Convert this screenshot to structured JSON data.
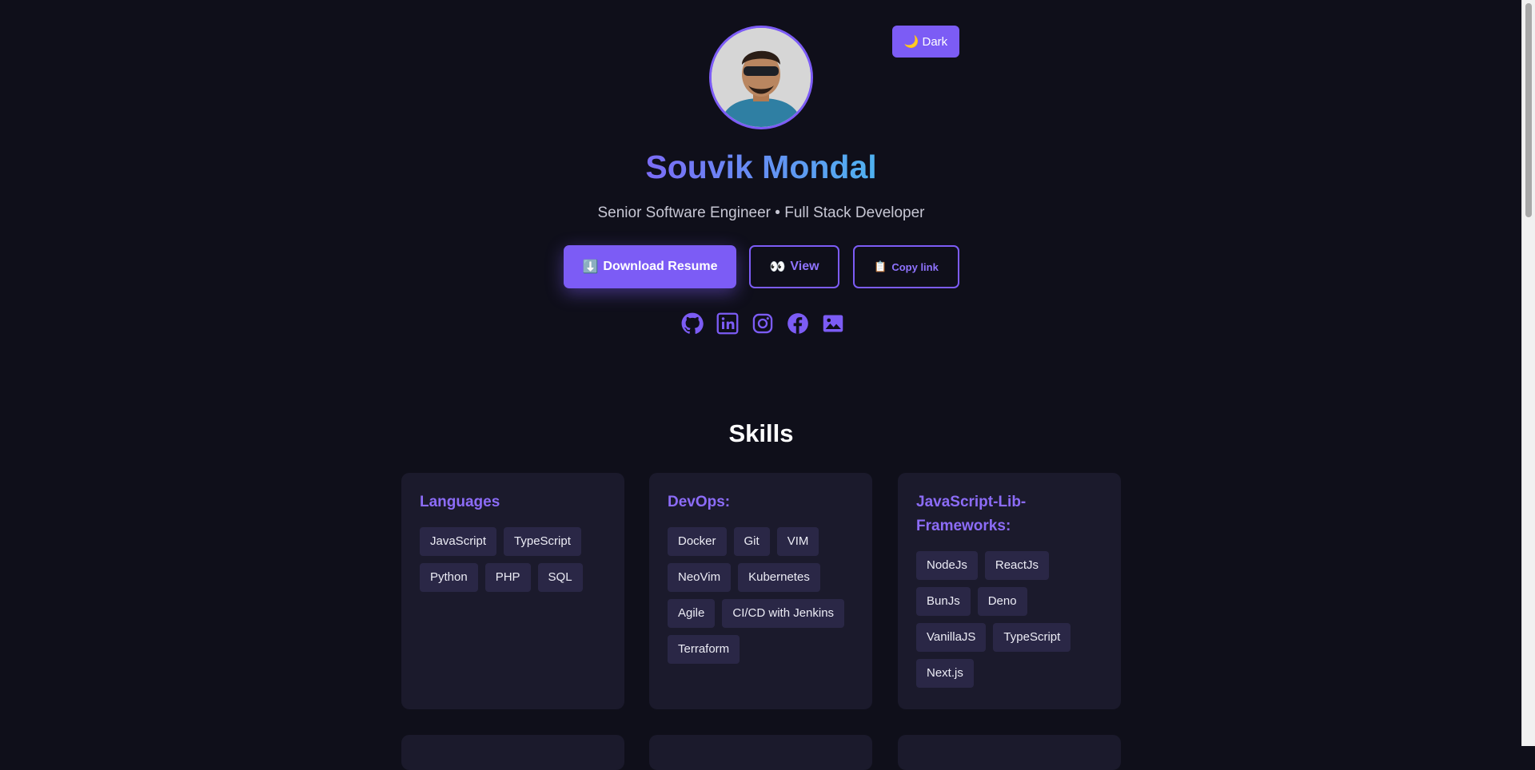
{
  "profile": {
    "name": "Souvik Mondal",
    "subtitle": "Senior Software Engineer • Full Stack Developer"
  },
  "theme_toggle": {
    "icon": "🌙",
    "label": "Dark"
  },
  "actions": {
    "download": {
      "icon": "⬇️",
      "label": "Download Resume"
    },
    "view": {
      "icon": "👀",
      "label": "View"
    },
    "copy": {
      "icon": "📋",
      "label": "Copy link"
    }
  },
  "socials": [
    "github-icon",
    "linkedin-icon",
    "instagram-icon",
    "facebook-icon",
    "gallery-icon"
  ],
  "skills": {
    "title": "Skills",
    "groups": [
      {
        "title": "Languages",
        "tags": [
          "JavaScript",
          "TypeScript",
          "Python",
          "PHP",
          "SQL"
        ]
      },
      {
        "title": "DevOps:",
        "tags": [
          "Docker",
          "Git",
          "VIM",
          "NeoVim",
          "Kubernetes",
          "Agile",
          "CI/CD with Jenkins",
          "Terraform"
        ]
      },
      {
        "title": "JavaScript-Lib-Frameworks:",
        "tags": [
          "NodeJs",
          "ReactJs",
          "BunJs",
          "Deno",
          "VanillaJS",
          "TypeScript",
          "Next.js"
        ]
      }
    ]
  },
  "colors": {
    "accent": "#7c5cf5",
    "background": "#0f0f1a",
    "card": "#1b1a2c",
    "tag": "#2a2746"
  }
}
